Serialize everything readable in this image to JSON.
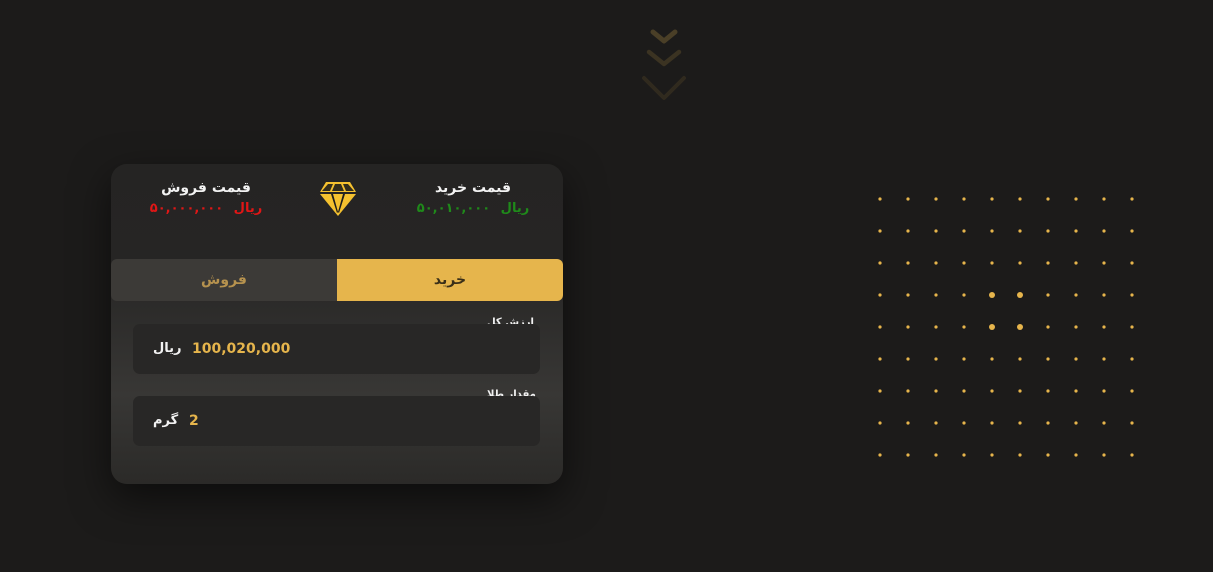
{
  "header": {
    "buy_price_title": "قیمت خرید",
    "buy_price_value": "۵۰,۰۱۰,۰۰۰",
    "buy_price_unit": "ریال",
    "sell_price_title": "قیمت فروش",
    "sell_price_value": "۵۰,۰۰۰,۰۰۰",
    "sell_price_unit": "ریال",
    "icon": "diamond-icon"
  },
  "tabs": {
    "sell_label": "فروش",
    "buy_label": "خرید",
    "active": "buy"
  },
  "form": {
    "total_value_label": "ارزش کل",
    "total_value": "100,020,000",
    "total_value_unit": "ریال",
    "gold_amount_label": "مقدار طلا",
    "gold_amount": "2",
    "gold_amount_unit": "گرم"
  },
  "decor": {
    "scroll_icon": "chevrons-down-icon",
    "dot_grid": "dot-grid"
  },
  "colors": {
    "accent": "#e6b54c",
    "background": "#1c1b1a",
    "buy_green": "#1f8a1a",
    "sell_red": "#e01616"
  }
}
